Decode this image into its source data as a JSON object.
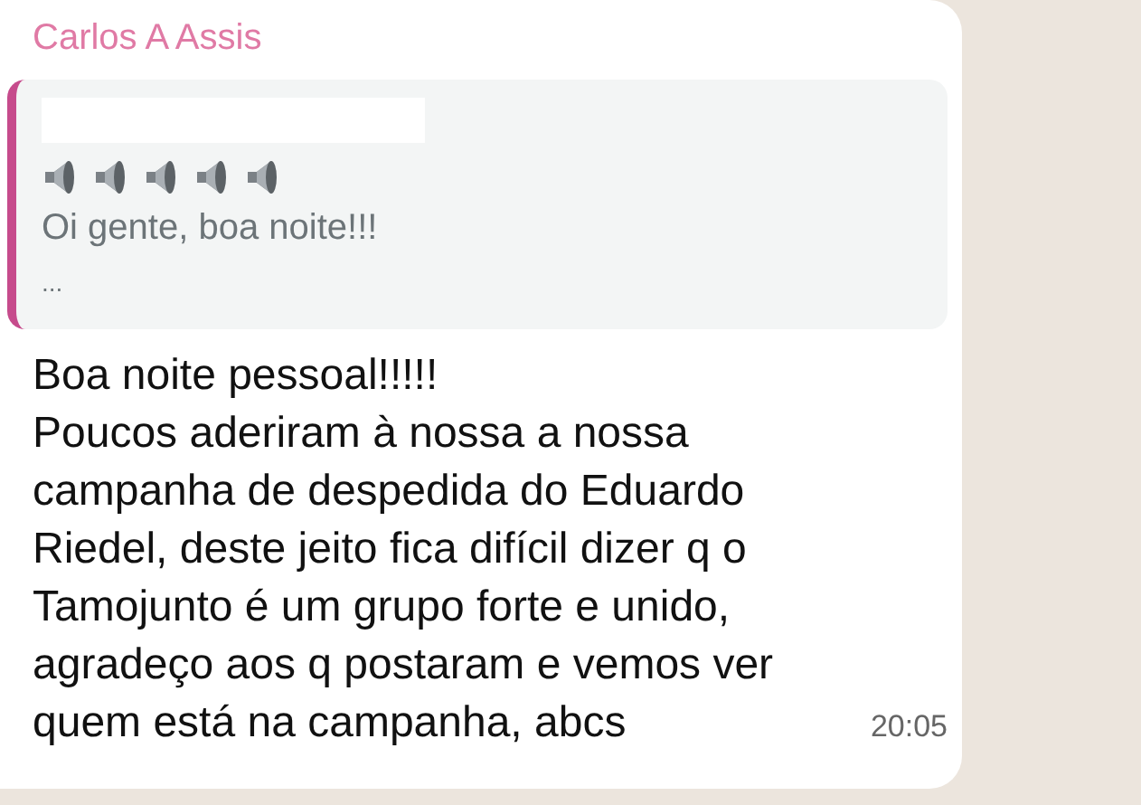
{
  "message": {
    "sender": "Carlos A Assis",
    "quote": {
      "text": "Oi gente, boa noite!!!",
      "more": "..."
    },
    "text": "Boa noite pessoal!!!!!\nPoucos aderiram à nossa a nossa\ncampanha de despedida do Eduardo\nRiedel, deste jeito fica difícil dizer q o\nTamojunto é um grupo forte e unido,\nagradeço aos q postaram e vemos ver\nquem está na campanha, abcs",
    "time": "20:05"
  }
}
